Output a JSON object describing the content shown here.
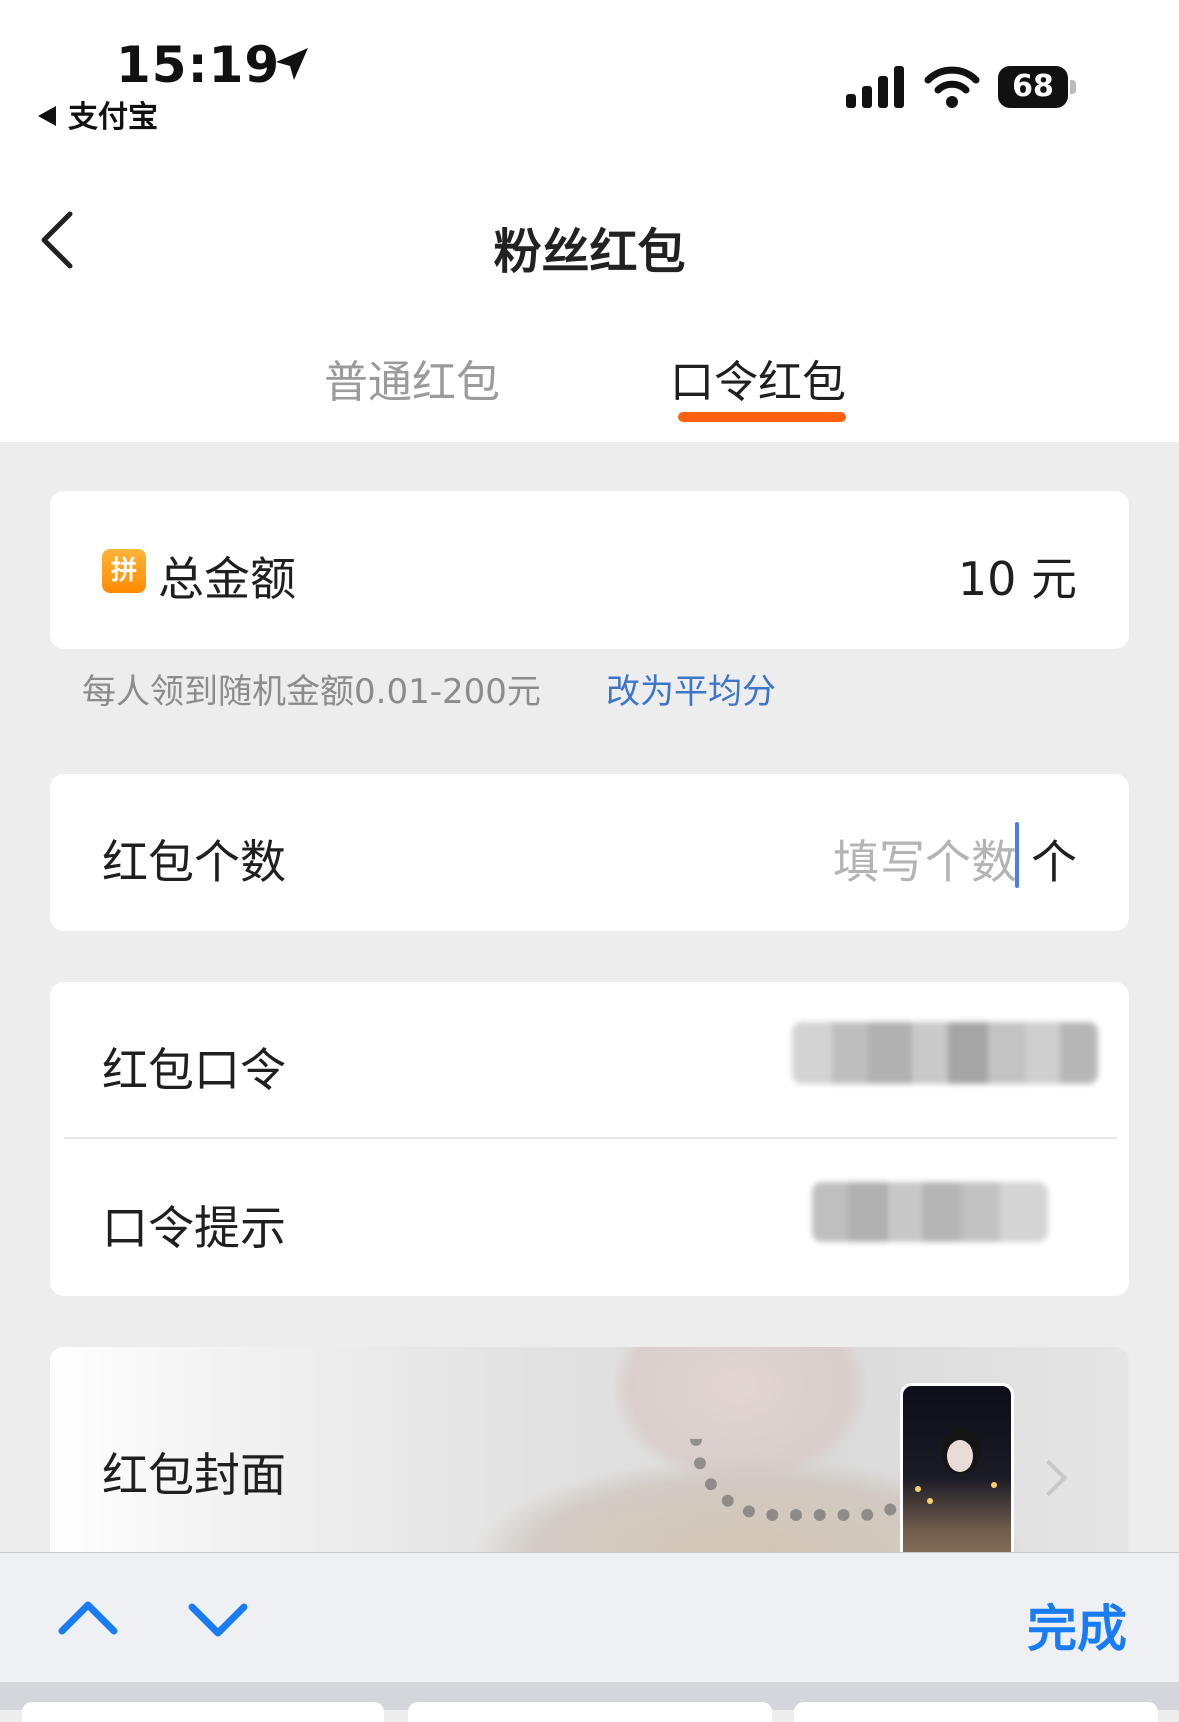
{
  "status_bar": {
    "time": "15:19",
    "back_app": "支付宝",
    "battery": "68"
  },
  "nav": {
    "title": "粉丝红包"
  },
  "tabs": [
    {
      "label": "普通红包",
      "active": false
    },
    {
      "label": "口令红包",
      "active": true
    }
  ],
  "colors": {
    "accent": "#ff6010",
    "link": "#3b76c9",
    "done": "#1a7cf5"
  },
  "amount_card": {
    "badge": "拼",
    "label": "总金额",
    "value": "10 元"
  },
  "hint": {
    "text": "每人领到随机金额0.01-200元",
    "link": "改为平均分"
  },
  "count_card": {
    "label": "红包个数",
    "placeholder": "填写个数",
    "unit": "个"
  },
  "password_card": {
    "password_label": "红包口令",
    "tip_label": "口令提示"
  },
  "cover_card": {
    "label": "红包封面"
  },
  "keyboard_toolbar": {
    "done": "完成"
  },
  "icons": [
    "location-arrow-icon",
    "signal-icon",
    "wifi-icon",
    "battery-icon",
    "back-chevron-icon",
    "chevron-right-icon",
    "chevron-up-icon",
    "chevron-down-icon"
  ]
}
